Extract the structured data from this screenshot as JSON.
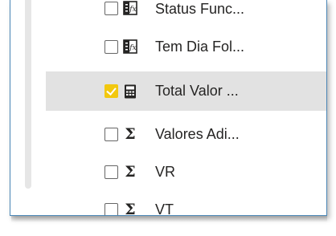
{
  "fields": [
    {
      "label": "Status Func...",
      "checked": false,
      "icon": "calculated-column-icon"
    },
    {
      "label": "Tem Dia Fol...",
      "checked": false,
      "icon": "calculated-column-icon"
    },
    {
      "label": "Total Valor ...",
      "checked": true,
      "icon": "measure-calculator-icon"
    },
    {
      "label": "Valores Adi...",
      "checked": false,
      "icon": "sigma-sum-icon"
    },
    {
      "label": "VR",
      "checked": false,
      "icon": "sigma-sum-icon"
    },
    {
      "label": "VT",
      "checked": false,
      "icon": "sigma-sum-icon"
    }
  ],
  "sigma_symbol": "Σ",
  "colors": {
    "accent": "#f2c80f",
    "selected_bg": "#e2e2e2",
    "frame": "#4a86b6"
  }
}
